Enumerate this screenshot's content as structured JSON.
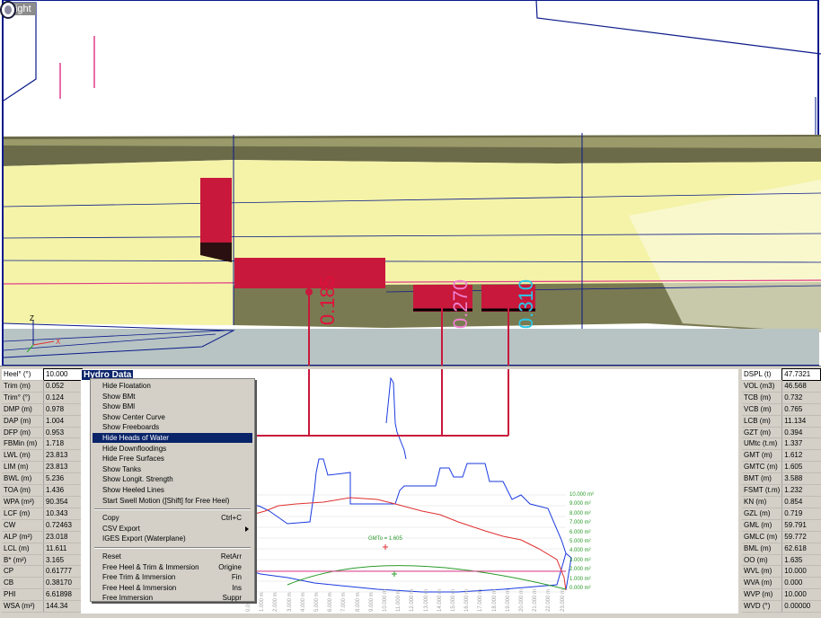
{
  "viewport": {
    "view_name": "Right",
    "axis_z": "Z",
    "axis_x": "X",
    "head_labels": [
      {
        "text": "0.185",
        "color": "#e0103a"
      },
      {
        "text": "0.270",
        "color": "#f080d0"
      },
      {
        "text": "0.310",
        "color": "#28c8e8"
      }
    ],
    "colors": {
      "hull_fill": "#f4f3a8",
      "hull_shade": "#6b6b4a",
      "waterline": "#e03c8a",
      "water": "#b8c4c4",
      "tank": "#c8183c",
      "outline": "#0a1a8a"
    }
  },
  "hydro": {
    "title": "Hydro Data",
    "left_rows": [
      {
        "label": "Heel° (°)",
        "value": "10.000"
      },
      {
        "label": "Trim (m)",
        "value": "0.052"
      },
      {
        "label": "Trim° (°)",
        "value": "0.124"
      },
      {
        "label": "DMP (m)",
        "value": "0.978"
      },
      {
        "label": "DAP (m)",
        "value": "1.004"
      },
      {
        "label": "DFP (m)",
        "value": "0.953"
      },
      {
        "label": "FBMin (m)",
        "value": "1.718"
      },
      {
        "label": "LWL (m)",
        "value": "23.813"
      },
      {
        "label": "LIM (m)",
        "value": "23.813"
      },
      {
        "label": "BWL (m)",
        "value": "5.236"
      },
      {
        "label": "TOA (m)",
        "value": "1.436"
      },
      {
        "label": "WPA (m²)",
        "value": "90.354"
      },
      {
        "label": "LCF (m)",
        "value": "10.343"
      },
      {
        "label": "CW",
        "value": "0.72463"
      },
      {
        "label": "ALP (m²)",
        "value": "23.018"
      },
      {
        "label": "LCL (m)",
        "value": "11.611"
      },
      {
        "label": "B* (m²)",
        "value": "3.165"
      },
      {
        "label": "CP",
        "value": "0.61777"
      },
      {
        "label": "CB",
        "value": "0.38170"
      },
      {
        "label": "PHI",
        "value": "6.61898"
      },
      {
        "label": "WSA (m²)",
        "value": "144.34"
      }
    ],
    "right_rows": [
      {
        "label": "DSPL (t)",
        "value": "47.7321"
      },
      {
        "label": "VOL (m3)",
        "value": "46.568"
      },
      {
        "label": "TCB (m)",
        "value": "0.732"
      },
      {
        "label": "VCB (m)",
        "value": "0.765"
      },
      {
        "label": "LCB (m)",
        "value": "11.134"
      },
      {
        "label": "GZT (m)",
        "value": "0.394"
      },
      {
        "label": "UMtc (t.m)",
        "value": "1.337"
      },
      {
        "label": "GMT (m)",
        "value": "1.612"
      },
      {
        "label": "GMTC (m)",
        "value": "1.605"
      },
      {
        "label": "BMT (m)",
        "value": "3.588"
      },
      {
        "label": "FSMT (t.m)",
        "value": "1.232"
      },
      {
        "label": "KN (m)",
        "value": "0.854"
      },
      {
        "label": "GZL (m)",
        "value": "0.719"
      },
      {
        "label": "GML (m)",
        "value": "59.791"
      },
      {
        "label": "GMLC (m)",
        "value": "59.772"
      },
      {
        "label": "BML (m)",
        "value": "62.618"
      },
      {
        "label": "OO (m)",
        "value": "1.635"
      },
      {
        "label": "WVL (m)",
        "value": "10.000"
      },
      {
        "label": "WVA (m)",
        "value": "0.000"
      },
      {
        "label": "WVP (m)",
        "value": "10.000"
      },
      {
        "label": "WVD (°)",
        "value": "0.00000"
      }
    ],
    "x_ticks": [
      "0.000 m",
      "1.000 m",
      "2.000 m",
      "3.000 m",
      "4.000 m",
      "5.000 m",
      "6.000 m",
      "7.000 m",
      "8.000 m",
      "9.000 m",
      "10.000 m",
      "11.000 m",
      "12.000 m",
      "13.000 m",
      "14.000 m",
      "15.000 m",
      "16.000 m",
      "17.000 m",
      "18.000 m",
      "19.000 m",
      "20.000 m",
      "21.000 m",
      "22.000 m",
      "23.000 m"
    ],
    "y_ticks": [
      "10.000 m²",
      "9.000 m²",
      "8.000 m²",
      "7.000 m²",
      "6.000 m²",
      "5.000 m²",
      "4.000 m²",
      "3.000 m²",
      "2.000 m²",
      "1.000 m²",
      "0.000 m²"
    ],
    "gmt_label": "GMTo = 1.605"
  },
  "context_menu": {
    "group1": [
      {
        "label": "Hide Floatation",
        "shortcut": ""
      },
      {
        "label": "Show BMt",
        "shortcut": ""
      },
      {
        "label": "Show BMl",
        "shortcut": ""
      },
      {
        "label": "Show Center Curve",
        "shortcut": ""
      },
      {
        "label": "Show Freeboards",
        "shortcut": ""
      },
      {
        "label": "Hide Heads of Water",
        "shortcut": "",
        "highlighted": true
      },
      {
        "label": "Hide Downfloodings",
        "shortcut": ""
      },
      {
        "label": "Hide Free Surfaces",
        "shortcut": ""
      },
      {
        "label": "Show Tanks",
        "shortcut": ""
      },
      {
        "label": "Show Longit. Strength",
        "shortcut": ""
      },
      {
        "label": "Show Heeled Lines",
        "shortcut": ""
      },
      {
        "label": "Start Swell Motion ([Shift] for Free Heel)",
        "shortcut": ""
      }
    ],
    "group2": [
      {
        "label": "Copy",
        "shortcut": "Ctrl+C"
      },
      {
        "label": "CSV Export",
        "shortcut": "",
        "submenu": true
      },
      {
        "label": "IGES Export (Waterplane)",
        "shortcut": ""
      }
    ],
    "group3": [
      {
        "label": "Reset",
        "shortcut": "RetArr"
      },
      {
        "label": "Free Heel & Trim & Immersion",
        "shortcut": "Origine"
      },
      {
        "label": "Free Trim & Immersion",
        "shortcut": "Fin"
      },
      {
        "label": "Free Heel & Immersion",
        "shortcut": "Ins"
      },
      {
        "label": "Free Immersion",
        "shortcut": "Suppr"
      }
    ]
  }
}
